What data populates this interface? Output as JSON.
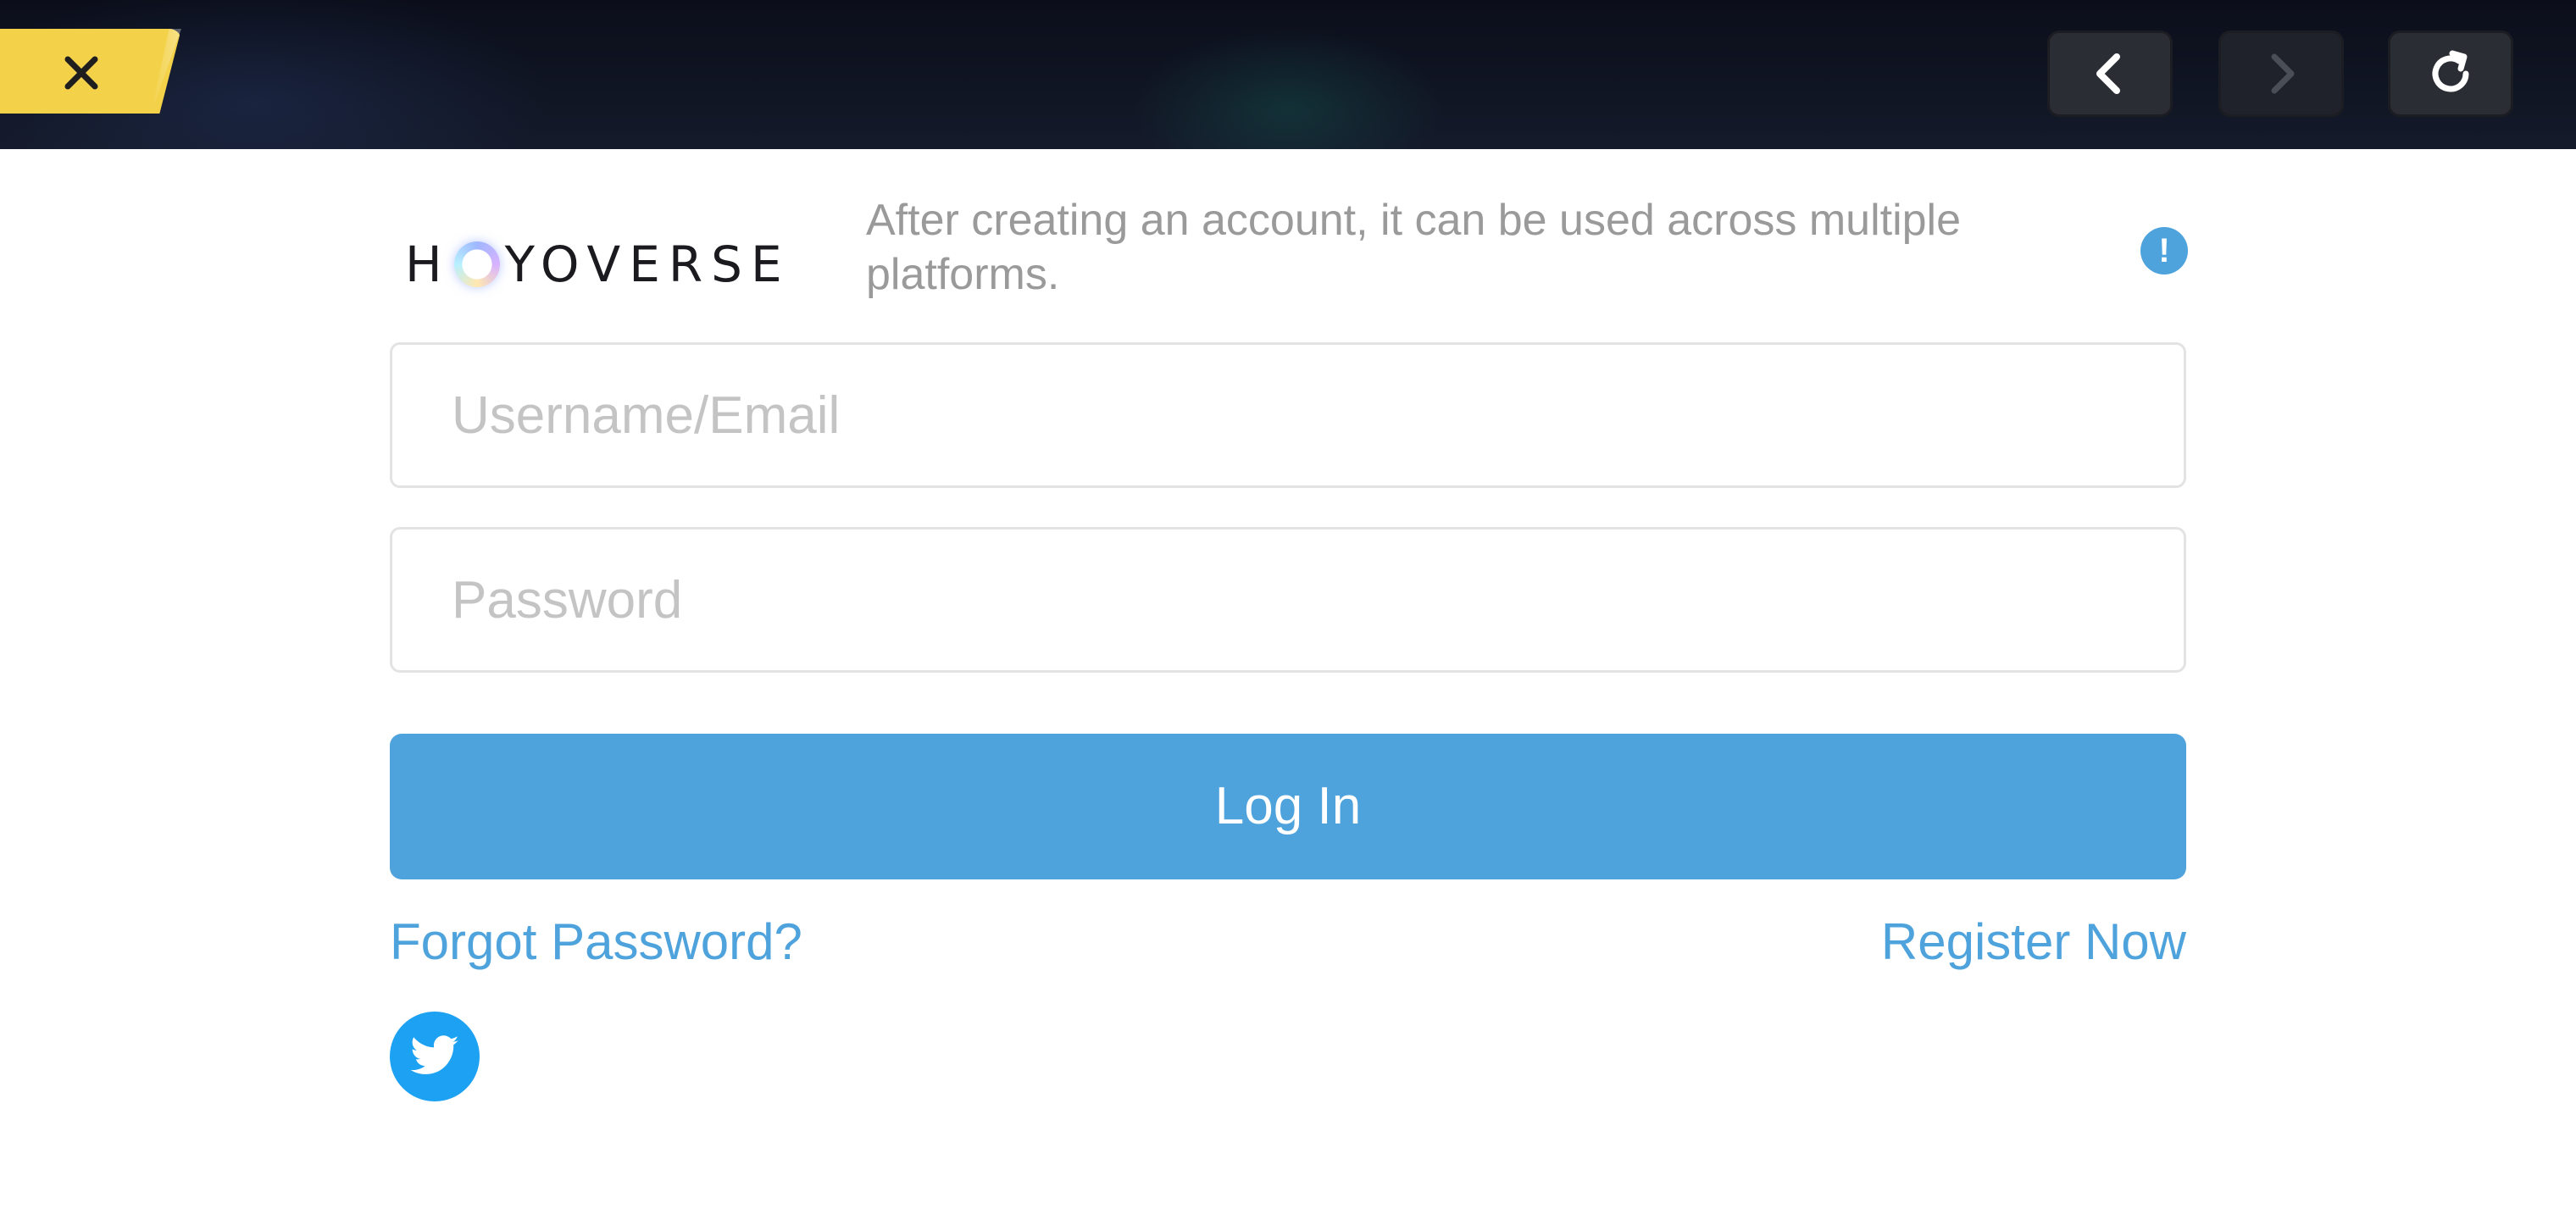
{
  "topbar": {
    "close_icon": "close-icon",
    "back_icon": "chevron-left-icon",
    "forward_icon": "chevron-right-icon",
    "refresh_icon": "refresh-icon",
    "close_tab_color": "#f3d24a"
  },
  "brand": {
    "logo_text_before": "H",
    "logo_text_after": "YOVERSE",
    "notice": "After creating an account, it can be used across multiple platforms.",
    "info_symbol": "!"
  },
  "form": {
    "username_placeholder": "Username/Email",
    "username_value": "",
    "password_placeholder": "Password",
    "password_value": "",
    "login_label": "Log In",
    "forgot_label": "Forgot Password?",
    "register_label": "Register Now"
  },
  "social": {
    "twitter_icon": "twitter-icon"
  },
  "colors": {
    "accent": "#4fa3dc",
    "twitter": "#1da1f2",
    "placeholder": "#c4c4c4",
    "notice_text": "#9a9a9a"
  }
}
